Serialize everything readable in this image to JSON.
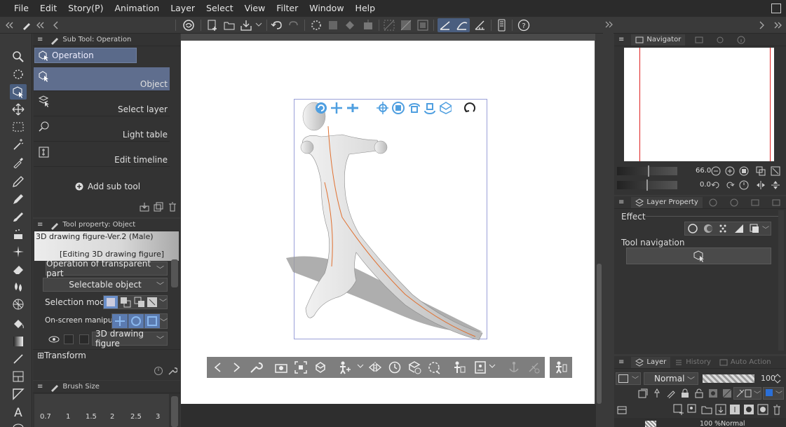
{
  "menu": [
    "File",
    "Edit",
    "Story(P)",
    "Animation",
    "Layer",
    "Select",
    "View",
    "Filter",
    "Window",
    "Help"
  ],
  "subtool": {
    "title": "Sub Tool: Operation",
    "group": "Operation",
    "items": [
      {
        "label": "Object",
        "icon": "object-cursor-icon"
      },
      {
        "label": "Select layer",
        "icon": "select-layer-icon"
      },
      {
        "label": "Light table",
        "icon": "light-table-icon"
      },
      {
        "label": "Edit timeline",
        "icon": "edit-timeline-icon"
      }
    ],
    "add_label": "Add sub tool"
  },
  "toolprop": {
    "title": "Tool property: Object",
    "figure_name": "3D drawing figure-Ver.2 (Male)",
    "editing_label": "[Editing 3D drawing figure]",
    "transparent_op": "Operation of transparent part",
    "selectable": "Selectable object",
    "selection_mode_label": "Selection mode",
    "manipulator_label": "On-screen manipulator",
    "layer_object": "3D drawing figure",
    "transform_label": "Transform"
  },
  "brush": {
    "title": "Brush Size",
    "sizes": [
      "0.7",
      "1",
      "1.5",
      "2",
      "2.5",
      "3"
    ]
  },
  "navigator": {
    "title": "Navigator",
    "zoom": "66.0",
    "angle": "0.0"
  },
  "layer_property": {
    "title": "Layer Property",
    "effect_label": "Effect",
    "tool_nav_label": "Tool navigation"
  },
  "layer": {
    "tabs": [
      "Layer",
      "History",
      "Auto Action"
    ],
    "blend_mode": "Normal",
    "opacity": "100",
    "row_text": "100 %Normal"
  },
  "colors": {
    "accent": "#4a5e7f",
    "selected_row": "#5f6e8e",
    "widget_blue": "#4f9fe0",
    "ruler_red": "#e02020"
  }
}
